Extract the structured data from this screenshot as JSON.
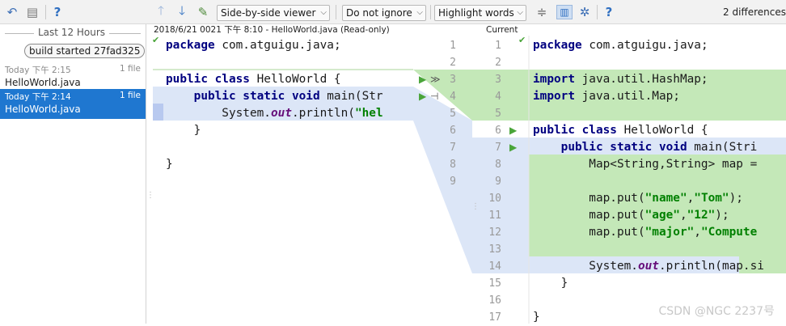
{
  "toolbar": {
    "viewer_mode": "Side-by-side viewer",
    "ignore_mode": "Do not ignore",
    "highlight_mode": "Highlight words",
    "differences": "2 differences"
  },
  "history": {
    "section_title": "Last 12 Hours",
    "build_label": "build started 27fad325",
    "items": [
      {
        "time": "Today 下午 2:15",
        "count": "1 file",
        "file": "HelloWorld.java"
      },
      {
        "time": "Today 下午 2:14",
        "count": "1 file",
        "file": "HelloWorld.java"
      }
    ]
  },
  "left_header": "2018/6/21 0021 下午 8:10 - HelloWorld.java (Read-only)",
  "right_header": "Current",
  "left_line_numbers": [
    "1",
    "2",
    "3",
    "4",
    "5",
    "6",
    "7",
    "8",
    "9"
  ],
  "right_line_numbers": [
    "1",
    "2",
    "3",
    "4",
    "5",
    "6",
    "7",
    "8",
    "9",
    "10",
    "11",
    "12",
    "13",
    "14",
    "15",
    "16",
    "17"
  ],
  "left_code": [
    "package com.atguigu.java;",
    "",
    "public class HelloWorld {",
    "    public static void main(Str",
    "        System.out.println(\"hel",
    "    }",
    "",
    "}",
    ""
  ],
  "right_code": [
    "package com.atguigu.java;",
    "",
    "import java.util.HashMap;",
    "import java.util.Map;",
    "",
    "public class HelloWorld {",
    "    public static void main(Stri",
    "        Map<String,String> map =",
    "",
    "        map.put(\"name\",\"Tom\");",
    "        map.put(\"age\",\"12\");",
    "        map.put(\"major\",\"Compute",
    "",
    "        System.out.println(map.si",
    "    }",
    "",
    "}"
  ],
  "watermark": "CSDN @NGC 2237号"
}
